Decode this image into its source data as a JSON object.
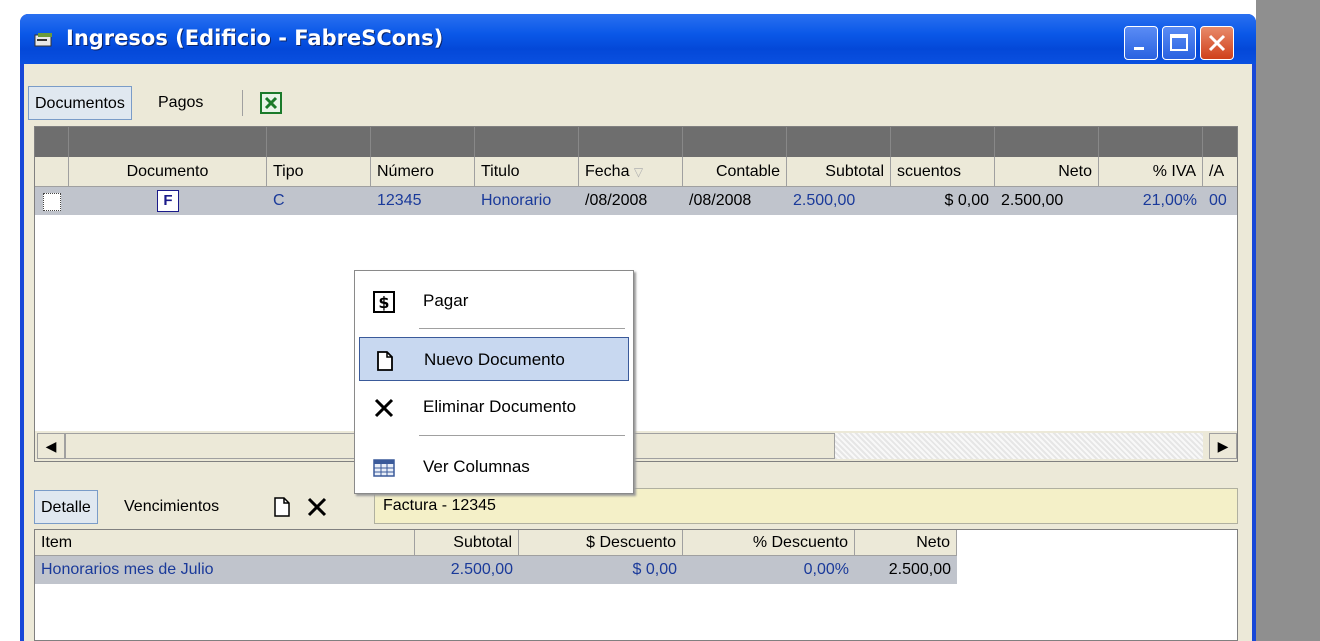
{
  "window": {
    "title": "Ingresos (Edificio - FabreSCons)",
    "accent": "#0a58e8"
  },
  "toolbar": {
    "tabs": [
      "Documentos",
      "Pagos"
    ],
    "excel_icon": "excel-icon"
  },
  "grid": {
    "columns": [
      "Documento",
      "Tipo",
      "Número",
      "Titulo",
      "Fecha",
      "Contable",
      "Subtotal",
      "scuentos",
      "Neto",
      "% IVA",
      "/A"
    ],
    "rows": [
      {
        "documento_icon": "F",
        "tipo": "C",
        "numero": "12345",
        "titulo": "Honorario",
        "fecha": "/08/2008",
        "contable": "/08/2008",
        "subtotal": "2.500,00",
        "descuentos": "$ 0,00",
        "neto": "2.500,00",
        "iva": "21,00%",
        "a": "00"
      }
    ]
  },
  "context_menu": {
    "items": [
      {
        "label": "Pagar",
        "icon": "dollar-icon"
      },
      {
        "label": "Nuevo Documento",
        "icon": "new-document-icon"
      },
      {
        "label": "Eliminar Documento",
        "icon": "delete-icon"
      },
      {
        "label": "Ver Columnas",
        "icon": "columns-icon"
      }
    ]
  },
  "bottom": {
    "tabs": [
      "Detalle",
      "Vencimientos"
    ],
    "filter_text": "Factura - 12345",
    "columns": [
      "Item",
      "Subtotal",
      "$ Descuento",
      "% Descuento",
      "Neto"
    ],
    "rows": [
      {
        "item": "Honorarios mes de Julio",
        "subtotal": "2.500,00",
        "descuento": "$ 0,00",
        "pct": "0,00%",
        "neto": "2.500,00"
      }
    ]
  }
}
